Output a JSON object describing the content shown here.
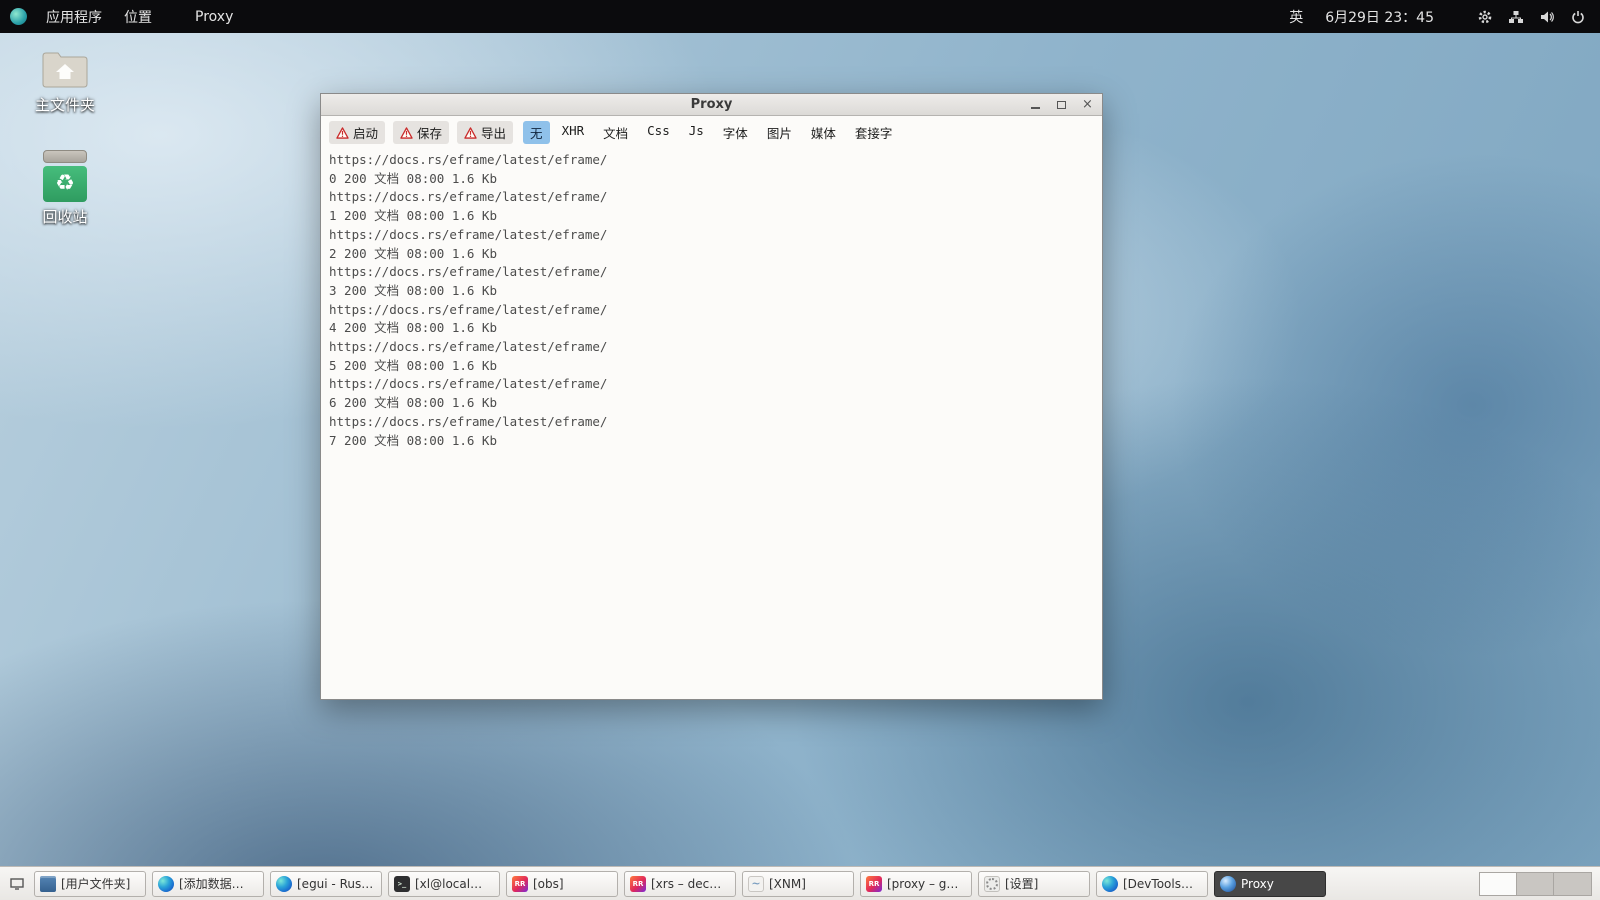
{
  "topbar": {
    "menus": [
      "应用程序",
      "位置"
    ],
    "app_name": "Proxy",
    "input_indicator": "英",
    "clock": "6月29日 23：45",
    "status_icons": [
      "settings-icon",
      "network-icon",
      "volume-icon",
      "power-icon"
    ]
  },
  "desktop": {
    "icons": [
      {
        "label": "主文件夹"
      },
      {
        "label": "回收站",
        "glyph": "♻"
      }
    ]
  },
  "window": {
    "title": "Proxy",
    "controls": {
      "close_glyph": "×"
    },
    "toolbar": {
      "actions": [
        "启动",
        "保存",
        "导出"
      ],
      "filters": [
        {
          "label": "无",
          "selected": true
        },
        {
          "label": "XHR"
        },
        {
          "label": "文档"
        },
        {
          "label": "Css"
        },
        {
          "label": "Js"
        },
        {
          "label": "字体"
        },
        {
          "label": "图片"
        },
        {
          "label": "媒体"
        },
        {
          "label": "套接字"
        }
      ]
    },
    "requests": [
      {
        "url": "https://docs.rs/eframe/latest/eframe/",
        "meta": "0 200 文档 08:00 1.6 Kb"
      },
      {
        "url": "https://docs.rs/eframe/latest/eframe/",
        "meta": "1 200 文档 08:00 1.6 Kb"
      },
      {
        "url": "https://docs.rs/eframe/latest/eframe/",
        "meta": "2 200 文档 08:00 1.6 Kb"
      },
      {
        "url": "https://docs.rs/eframe/latest/eframe/",
        "meta": "3 200 文档 08:00 1.6 Kb"
      },
      {
        "url": "https://docs.rs/eframe/latest/eframe/",
        "meta": "4 200 文档 08:00 1.6 Kb"
      },
      {
        "url": "https://docs.rs/eframe/latest/eframe/",
        "meta": "5 200 文档 08:00 1.6 Kb"
      },
      {
        "url": "https://docs.rs/eframe/latest/eframe/",
        "meta": "6 200 文档 08:00 1.6 Kb"
      },
      {
        "url": "https://docs.rs/eframe/latest/eframe/",
        "meta": "7 200 文档 08:00 1.6 Kb"
      }
    ]
  },
  "taskbar": {
    "items": [
      {
        "label": "[用户文件夹]",
        "icon": "folder"
      },
      {
        "label": "[添加数据…",
        "icon": "browser"
      },
      {
        "label": "[egui - Rus…",
        "icon": "browser"
      },
      {
        "label": "[xl@local…",
        "icon": "terminal"
      },
      {
        "label": "[obs]",
        "icon": "rustrover"
      },
      {
        "label": "[xrs – dec…",
        "icon": "rustrover"
      },
      {
        "label": "[XNM]",
        "icon": "xnm"
      },
      {
        "label": "[proxy – g…",
        "icon": "rustrover"
      },
      {
        "label": "[设置]",
        "icon": "settings"
      },
      {
        "label": "[DevTools…",
        "icon": "browser"
      },
      {
        "label": "Proxy",
        "icon": "proxy",
        "active": true
      }
    ],
    "workspace_count": 3
  },
  "colors": {
    "filter_selected_bg": "#8fc1ea",
    "warning_red": "#c92a2a",
    "active_task_bg": "#474747",
    "recycle_green": "#3aad6e",
    "panel_bg": "#0b0b0d"
  }
}
